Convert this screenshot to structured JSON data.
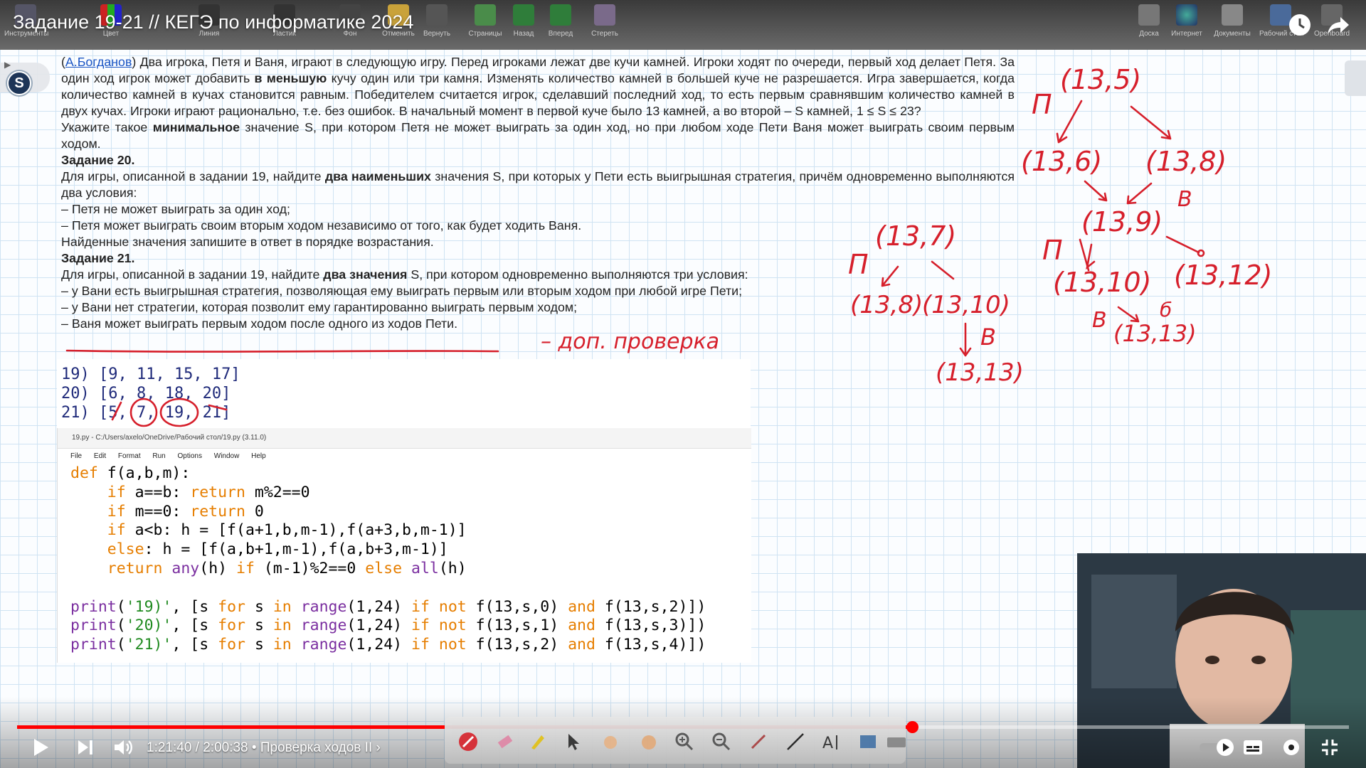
{
  "video": {
    "title": "Задание 19-21 // КЕГЭ по информатике 2024",
    "time": "1:21:40 / 2:00:38",
    "chapter": "• Проверка ходов II ›",
    "progress": 0.672
  },
  "toolbar": {
    "labels": [
      "Инструменты",
      "Цвет",
      "Линия",
      "Ластик",
      "Фон",
      "Отменить",
      "Вернуть",
      "Страницы",
      "Назад",
      "Вперед",
      "Стереть"
    ],
    "right_labels": [
      "Доска",
      "Интернет",
      "Документы",
      "Рабочий стол",
      "Openboard"
    ]
  },
  "side": {
    "s_button": "S"
  },
  "task": {
    "p1_link": "А.Богданов",
    "p1_a": ") Два игрока, Петя и Ваня, играют в следующую игру. Перед игроками лежат две кучи камней. Игроки ходят по очереди, первый ход делает Петя. За один ход игрок может добавить ",
    "p1_bold": "в меньшую",
    "p1_b": " кучу один или три камня. Изменять количество камней в большей куче не разрешается. Игра завершается, когда количество камней в кучах становится равным. Победителем считается игрок, сделавший последний ход, то есть первым сравнявшим количество камней в двух кучах. Игроки играют рационально, т.е. без ошибок. В начальный момент в первой куче было 13 камней, а во второй – S камней, 1 ≤ S ≤ 23?",
    "p2_a": "Укажите такое ",
    "p2_bold": "минимальное",
    "p2_b": " значение S, при котором Петя не может выиграть за один ход, но при любом ходе Пети Ваня может выиграть своим первым ходом.",
    "h20": "Задание 20.",
    "p3_a": "Для игры, описанной в задании 19, найдите ",
    "p3_bold": "два наименьших",
    "p3_b": " значения S, при которых у Пети есть выигрышная стратегия, причём одновременно выполняются два условия:",
    "l20_1": "– Петя не может выиграть за один ход;",
    "l20_2": " – Петя может выиграть своим вторым ходом независимо от того, как будет ходить Ваня.",
    "p4": "Найденные значения запишите в ответ в порядке возрастания.",
    "h21": "Задание 21.",
    "p5_a": "Для игры, описанной в задании 19, найдите ",
    "p5_bold": "два значения",
    "p5_b": " S, при котором одновременно выполняются три условия:",
    "l21_1": "– у Вани есть выигрышная стратегия, позволяющая ему выиграть первым или вторым ходом при любой игре Пети;",
    "l21_2": " – у Вани нет стратегии, которая позволит ему гарантированно выиграть первым ходом;",
    "l21_3": "– Ваня может выиграть первым ходом после одного из ходов Пети."
  },
  "output": {
    "line19": "19) [9, 11, 15, 17]",
    "line20": "20) [6, 8, 18, 20]",
    "line21": "21) [5, 7, 19, 21]"
  },
  "idle": {
    "title": "19.py - C:/Users/axelo/OneDrive/Рабочий стол/19.py (3.11.0)",
    "menu": [
      "File",
      "Edit",
      "Format",
      "Run",
      "Options",
      "Window",
      "Help"
    ]
  },
  "annotations": {
    "dop_check": "– доп. проверка",
    "tree1": {
      "root": "(13,5)",
      "l1_left": "(13,6)",
      "l1_right": "(13,8)",
      "l2": "(13,9)",
      "l3_left": "(13,10)",
      "l3_right": "(13,12)",
      "l4": "(13,13)",
      "P1": "П",
      "V1": "В",
      "P2": "П",
      "V2": "В",
      "B2": "б"
    },
    "tree2": {
      "root": "(13,7)",
      "left": "(13,8)",
      "right": "(13,10)",
      "bottom": "(13,13)",
      "P": "П",
      "V": "В"
    }
  },
  "colors": {
    "accent": "#e8232f",
    "progress": "#ff0000",
    "ink": "#d61f2b"
  }
}
